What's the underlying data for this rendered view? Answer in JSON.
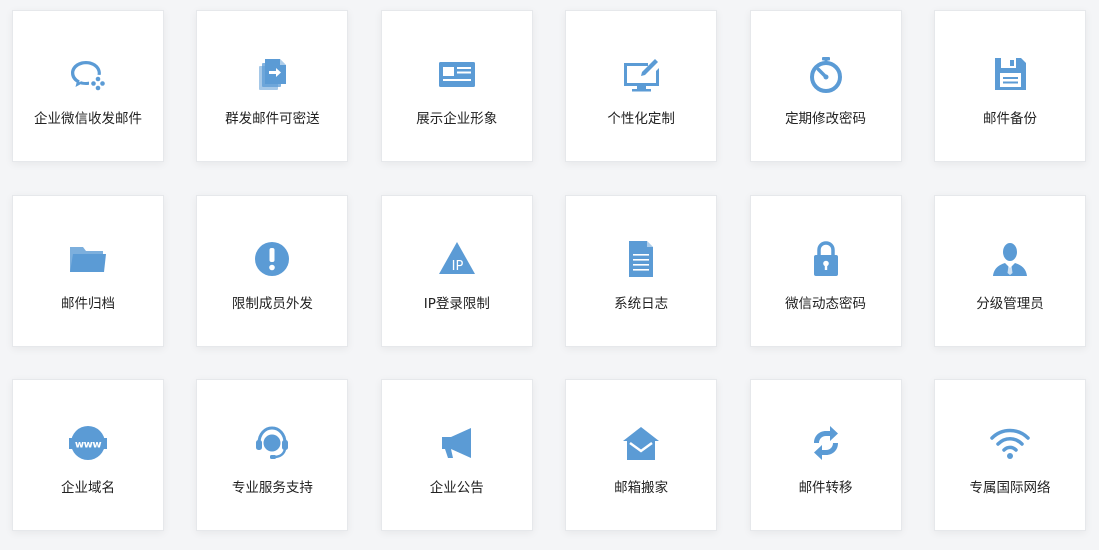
{
  "colors": {
    "icon": "#5b9bd5",
    "card_bg": "#ffffff",
    "page_bg": "#f4f5f7",
    "label": "#222222"
  },
  "features": [
    {
      "label": "企业微信收发邮件",
      "icon": "wecom-icon"
    },
    {
      "label": "群发邮件可密送",
      "icon": "mass-mail-icon"
    },
    {
      "label": "展示企业形象",
      "icon": "business-card-icon"
    },
    {
      "label": "个性化定制",
      "icon": "monitor-pen-icon"
    },
    {
      "label": "定期修改密码",
      "icon": "stopwatch-icon"
    },
    {
      "label": "邮件备份",
      "icon": "floppy-disk-icon"
    },
    {
      "label": "邮件归档",
      "icon": "folder-icon"
    },
    {
      "label": "限制成员外发",
      "icon": "exclamation-icon"
    },
    {
      "label": "IP登录限制",
      "icon": "ip-warning-icon"
    },
    {
      "label": "系统日志",
      "icon": "document-icon"
    },
    {
      "label": "微信动态密码",
      "icon": "lock-icon"
    },
    {
      "label": "分级管理员",
      "icon": "admin-user-icon"
    },
    {
      "label": "企业域名",
      "icon": "www-globe-icon"
    },
    {
      "label": "专业服务支持",
      "icon": "headset-icon"
    },
    {
      "label": "企业公告",
      "icon": "megaphone-icon"
    },
    {
      "label": "邮箱搬家",
      "icon": "mailbox-move-icon"
    },
    {
      "label": "邮件转移",
      "icon": "sync-arrows-icon"
    },
    {
      "label": "专属国际网络",
      "icon": "wifi-icon"
    }
  ]
}
